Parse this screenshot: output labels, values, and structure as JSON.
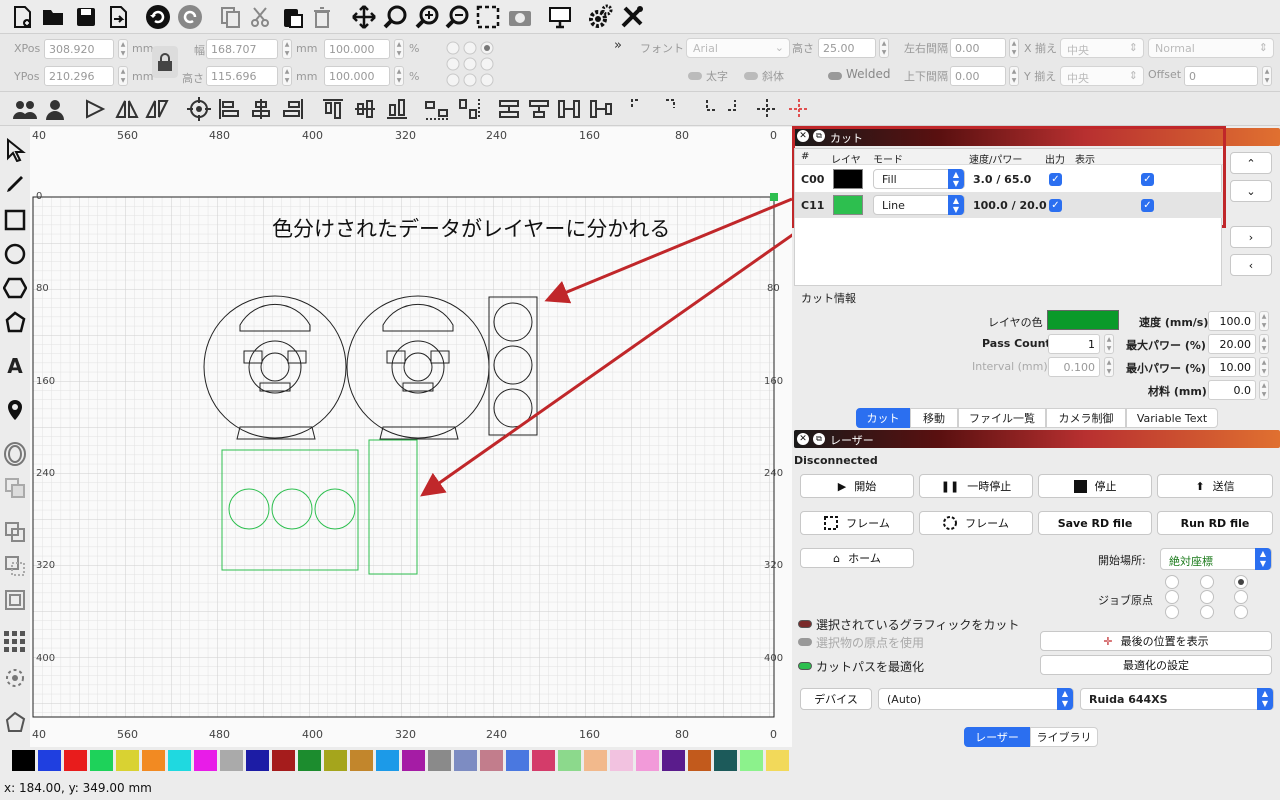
{
  "toolbar2": {
    "xpos_label": "XPos",
    "xpos_value": "308.920",
    "ypos_label": "YPos",
    "ypos_value": "210.296",
    "width_label": "幅",
    "width_value": "168.707",
    "height_label": "高さ",
    "height_value": "115.696",
    "unit": "mm",
    "scale_w": "100.000",
    "scale_h": "100.000",
    "percent": "%",
    "font_label": "フォント",
    "font_value": "Arial",
    "font_height_label": "高さ",
    "font_height_value": "25.00",
    "hspace_label": "左右間隔",
    "hspace_value": "0.00",
    "vspace_label": "上下間隔",
    "vspace_value": "0.00",
    "xalign_label": "X 揃え",
    "xalign_value": "中央",
    "yalign_label": "Y 揃え",
    "yalign_value": "中央",
    "style_value": "Normal",
    "offset_label": "Offset",
    "offset_value": "0",
    "bold_label": "太字",
    "italic_label": "斜体",
    "welded_label": "Welded"
  },
  "ruler": {
    "top": [
      "40",
      "560",
      "480",
      "400",
      "320",
      "240",
      "160",
      "80",
      "0"
    ],
    "bottom": [
      "40",
      "560",
      "480",
      "400",
      "320",
      "240",
      "160",
      "80",
      "0"
    ],
    "left": [
      "0",
      "80",
      "160",
      "240",
      "320",
      "400"
    ],
    "right": [
      "80",
      "160",
      "240",
      "320",
      "400"
    ]
  },
  "annotation": {
    "text": "色分けされたデータがレイヤーに分かれる"
  },
  "cut_panel": {
    "title": "カット",
    "headers": [
      "#",
      "レイヤ",
      "モード",
      "速度/パワー",
      "出力",
      "表示"
    ],
    "layers": [
      {
        "id": "C00",
        "color": "#000000",
        "mode": "Fill",
        "speed_power": "3.0 / 65.0"
      },
      {
        "id": "C11",
        "color": "#2dbf4f",
        "mode": "Line",
        "speed_power": "100.0 / 20.0"
      }
    ],
    "info_label": "カット情報",
    "layer_color_label": "レイヤの色",
    "layer_color": "#0a9a2a",
    "pass_count_label": "Pass Count",
    "pass_count_value": "1",
    "interval_label": "Interval (mm)",
    "interval_value": "0.100",
    "speed_label": "速度 (mm/s)",
    "speed_value": "100.0",
    "max_power_label": "最大パワー (%)",
    "max_power_value": "20.00",
    "min_power_label": "最小パワー (%)",
    "min_power_value": "10.00",
    "material_label": "材料 (mm)",
    "material_value": "0.0",
    "tabs": [
      "カット",
      "移動",
      "ファイル一覧",
      "カメラ制御",
      "Variable Text"
    ]
  },
  "laser_panel": {
    "title": "レーザー",
    "status": "Disconnected",
    "start": "開始",
    "pause": "一時停止",
    "stop": "停止",
    "send": "送信",
    "frame1": "フレーム",
    "frame2": "フレーム",
    "save_rd": "Save RD file",
    "run_rd": "Run RD file",
    "home": "ホーム",
    "start_from_label": "開始場所:",
    "start_from_value": "絶対座標",
    "job_origin_label": "ジョブ原点",
    "cut_selected": "選択されているグラフィックをカット",
    "use_selection_origin": "選択物の原点を使用",
    "optimize_path": "カットパスを最適化",
    "show_last_position": "最後の位置を表示",
    "optimize_settings": "最適化の設定",
    "device_label": "デバイス",
    "device_port": "(Auto)",
    "device_model": "Ruida 644XS",
    "tabs": [
      "レーザー",
      "ライブラリ"
    ]
  },
  "palette": [
    "#000000",
    "#1f3fe0",
    "#e81c1c",
    "#1ed25a",
    "#d9d232",
    "#f28a22",
    "#1fd9e0",
    "#e81ce8",
    "#aaaaaa",
    "#1c1ca5",
    "#a51c1c",
    "#1c8c2e",
    "#a5a51c",
    "#c2862c",
    "#1c9ae8",
    "#a51ca5",
    "#8a8a8a",
    "#7d8cc2",
    "#c27d8c",
    "#4a78e0",
    "#d43c6a",
    "#8cd98c",
    "#f2b98c",
    "#f2c2e0",
    "#f29ad9",
    "#5a1c8c",
    "#c25a1c",
    "#1c5a5a",
    "#8cf28c",
    "#f2d95a"
  ],
  "status_bar": {
    "coords": "x: 184.00, y: 349.00 mm"
  }
}
